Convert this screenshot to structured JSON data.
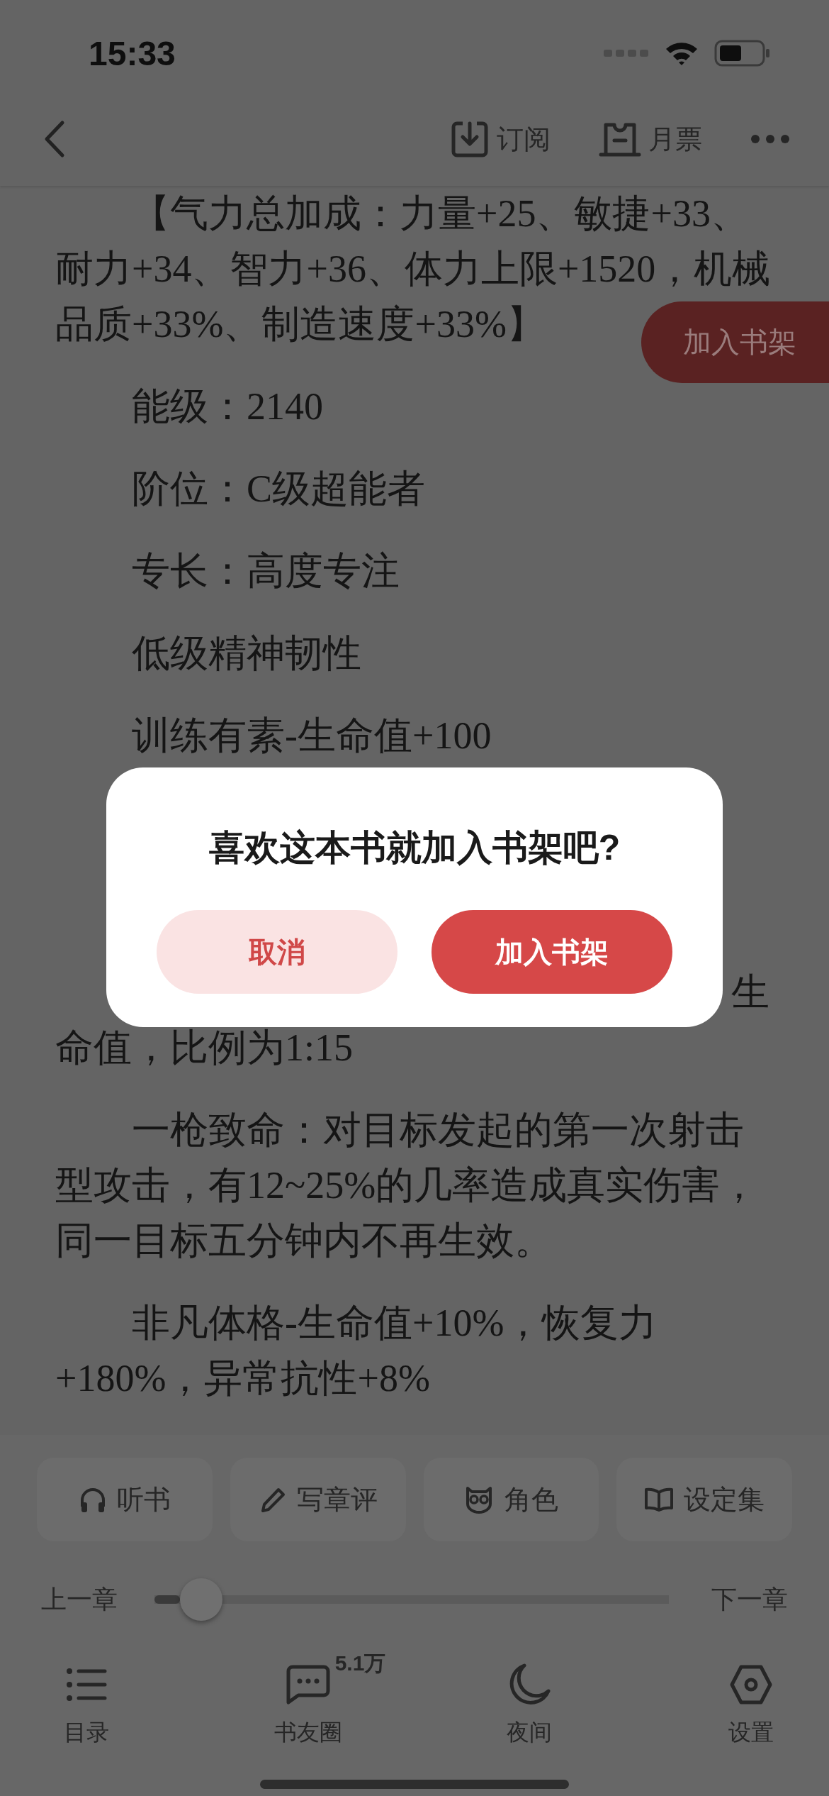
{
  "status_bar": {
    "time": "15:33"
  },
  "header": {
    "actions": [
      {
        "label": "订阅",
        "kind": "download"
      },
      {
        "label": "月票",
        "kind": "ticket"
      }
    ]
  },
  "floating_button": {
    "label": "加入书架"
  },
  "paragraphs": [
    {
      "kind": "text",
      "lines": [
        "【气力总加成：力量+25、敏捷+33、",
        "耐力+34、智力+36、体力上限+1520，机械",
        "品质+33%、制造速度+33%】"
      ]
    },
    {
      "kind": "text",
      "lines": [
        "能级：2140"
      ]
    },
    {
      "kind": "text",
      "lines": [
        "阶位：C级超能者"
      ]
    },
    {
      "kind": "text",
      "lines": [
        "专长：高度专注"
      ]
    },
    {
      "kind": "text",
      "lines": [
        "低级精神韧性"
      ]
    },
    {
      "kind": "text",
      "lines": [
        "训练有素-生命值+100"
      ]
    },
    {
      "kind": "obscured",
      "lines": [
        "生",
        "命值，比例为1:15"
      ]
    },
    {
      "kind": "text",
      "lines": [
        "一枪致命：对目标发起的第一次射击",
        "型攻击，有12~25%的几率造成真实伤害，",
        "同一目标五分钟内不再生效。"
      ]
    },
    {
      "kind": "text",
      "lines": [
        "非凡体格-生命值+10%，恢复力",
        "+180%，异常抗性+8%"
      ]
    }
  ],
  "dialog": {
    "title": "喜欢这本书就加入书架吧?",
    "buttons": [
      {
        "label": "取消",
        "kind": "secondary"
      },
      {
        "label": "加入书架",
        "kind": "primary"
      }
    ]
  },
  "tools": [
    {
      "label": "听书",
      "kind": "headphones"
    },
    {
      "label": "写章评",
      "kind": "pencil"
    },
    {
      "label": "角色",
      "kind": "owl"
    },
    {
      "label": "设定集",
      "kind": "book"
    }
  ],
  "chapter_slider": {
    "prev": "上一章",
    "next": "下一章",
    "level": 0.05
  },
  "nav": [
    {
      "label": "目录",
      "kind": "list"
    },
    {
      "label": "书友圈",
      "kind": "chat",
      "badge": "5.1万"
    },
    {
      "label": "夜间",
      "kind": "moon"
    },
    {
      "label": "设置",
      "kind": "settings"
    }
  ]
}
